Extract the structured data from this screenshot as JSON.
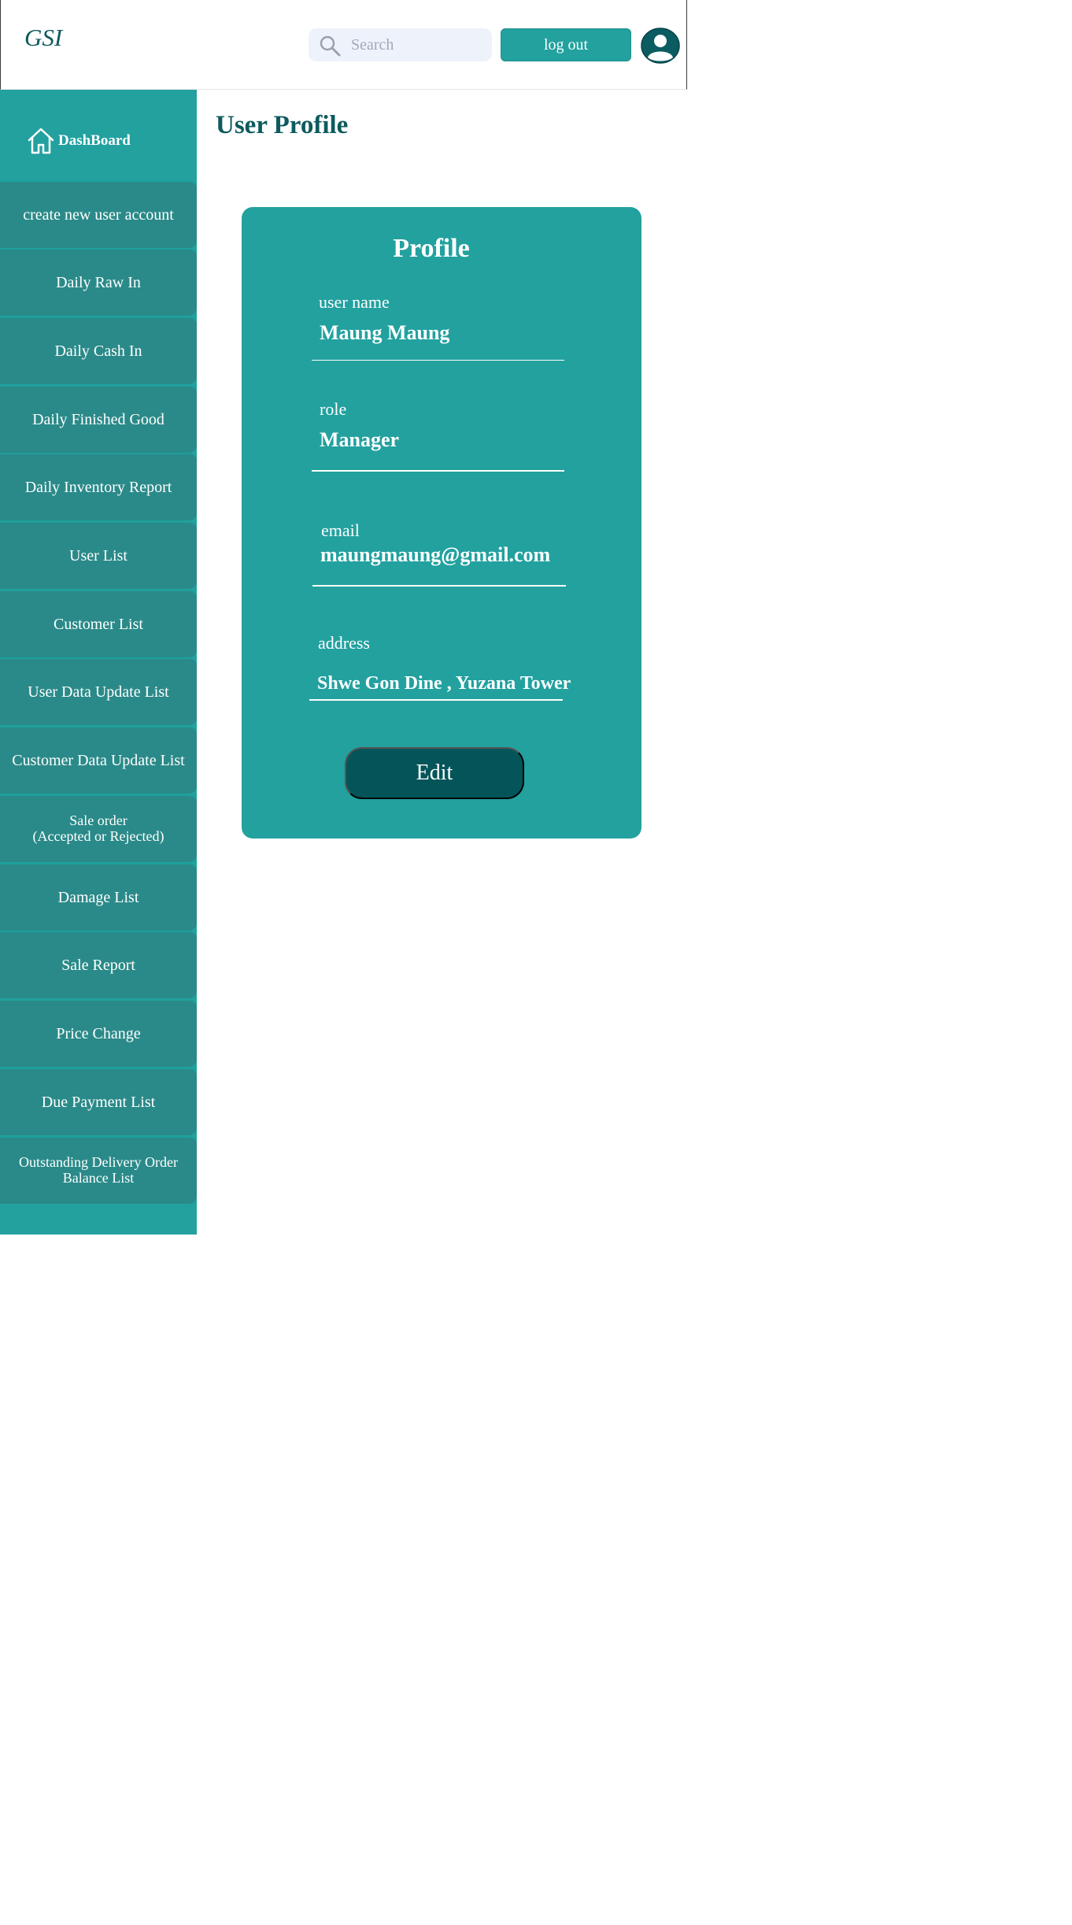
{
  "header": {
    "logo": "GSI",
    "search_placeholder": "Search",
    "logout_label": "log out"
  },
  "sidebar": {
    "dashboard_label": "DashBoard",
    "items": [
      {
        "label": "create new user account"
      },
      {
        "label": "Daily Raw In"
      },
      {
        "label": "Daily Cash In"
      },
      {
        "label": "Daily Finished Good"
      },
      {
        "label": "Daily Inventory Report"
      },
      {
        "label": "User List"
      },
      {
        "label": "Customer List"
      },
      {
        "label": "User Data Update List"
      },
      {
        "label": "Customer Data Update List"
      },
      {
        "label_line1": "Sale order",
        "label_line2": "(Accepted or Rejected)"
      },
      {
        "label": "Damage List"
      },
      {
        "label": "Sale Report"
      },
      {
        "label": "Price Change"
      },
      {
        "label": "Due Payment List"
      },
      {
        "label_line1": "Outstanding Delivery Order",
        "label_line2": "Balance List"
      }
    ]
  },
  "main": {
    "page_title": "User Profile",
    "profile": {
      "title": "Profile",
      "username_label": "user name",
      "username_value": "Maung Maung",
      "role_label": "role",
      "role_value": "Manager",
      "email_label": "email",
      "email_value": "maungmaung@gmail.com",
      "address_label": "address",
      "address_value": "Shwe Gon Dine , Yuzana Tower",
      "edit_label": "Edit"
    }
  },
  "colors": {
    "primary": "#22a19f",
    "sidebar_item": "#2a8a89",
    "dark_teal": "#04555a",
    "title_text": "#0e5a5e"
  }
}
